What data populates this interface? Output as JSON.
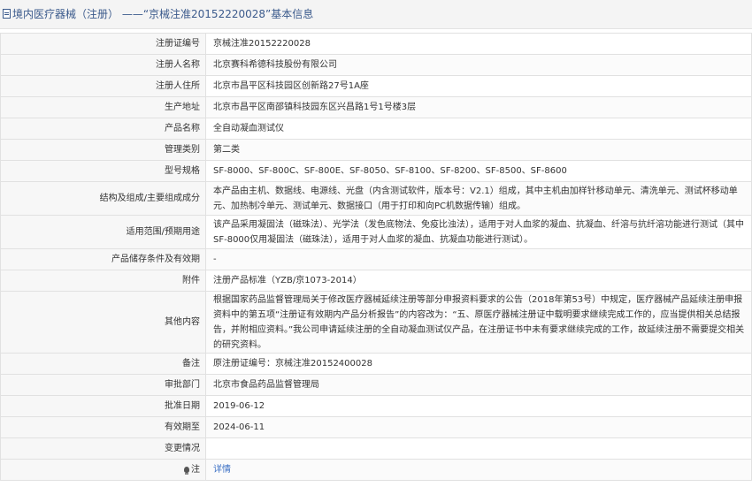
{
  "header": {
    "title": "境内医疗器械（注册） ——“京械注准20152220028”基本信息"
  },
  "rows": [
    {
      "label": "注册证编号",
      "value": "京械注准20152220028"
    },
    {
      "label": "注册人名称",
      "value": "北京赛科希德科技股份有限公司"
    },
    {
      "label": "注册人住所",
      "value": "北京市昌平区科技园区创新路27号1A座"
    },
    {
      "label": "生产地址",
      "value": "北京市昌平区南邵镇科技园东区兴昌路1号1号楼3层"
    },
    {
      "label": "产品名称",
      "value": "全自动凝血测试仪"
    },
    {
      "label": "管理类别",
      "value": "第二类"
    },
    {
      "label": "型号规格",
      "value": "SF-8000、SF-800C、SF-800E、SF-8050、SF-8100、SF-8200、SF-8500、SF-8600"
    },
    {
      "label": "结构及组成/主要组成成分",
      "value": "本产品由主机、数据线、电源线、光盘（内含测试软件，版本号：V2.1）组成，其中主机由加样针移动单元、清洗单元、测试杯移动单元、加热制冷单元、测试单元、数据接口（用于打印和向PC机数据传输）组成。"
    },
    {
      "label": "适用范围/预期用途",
      "value": "该产品采用凝固法（磁珠法）、光学法（发色底物法、免疫比浊法），适用于对人血浆的凝血、抗凝血、纤溶与抗纤溶功能进行测试（其中SF-8000仅用凝固法（磁珠法），适用于对人血浆的凝血、抗凝血功能进行测试）。"
    },
    {
      "label": "产品储存条件及有效期",
      "value": "-"
    },
    {
      "label": "附件",
      "value": "注册产品标准（YZB/京1073-2014）"
    },
    {
      "label": "其他内容",
      "value": "根据国家药品监督管理局关于修改医疗器械延续注册等部分申报资料要求的公告（2018年第53号）中规定，医疗器械产品延续注册申报资料中的第五项“注册证有效期内产品分析报告”的内容改为：“五、原医疗器械注册证中载明要求继续完成工作的，应当提供相关总结报告，并附相应资料。”我公司申请延续注册的全自动凝血测试仪产品，在注册证书中未有要求继续完成的工作，故延续注册不需要提交相关的研究资料。"
    },
    {
      "label": "备注",
      "value": "原注册证编号：京械注准20152400028"
    },
    {
      "label": "审批部门",
      "value": "北京市食品药品监督管理局"
    },
    {
      "label": "批准日期",
      "value": "2019-06-12"
    },
    {
      "label": "有效期至",
      "value": "2024-06-11"
    },
    {
      "label": "变更情况",
      "value": ""
    }
  ],
  "note": {
    "label": "注",
    "link_text": "详情",
    "icon": "bulb-icon"
  }
}
